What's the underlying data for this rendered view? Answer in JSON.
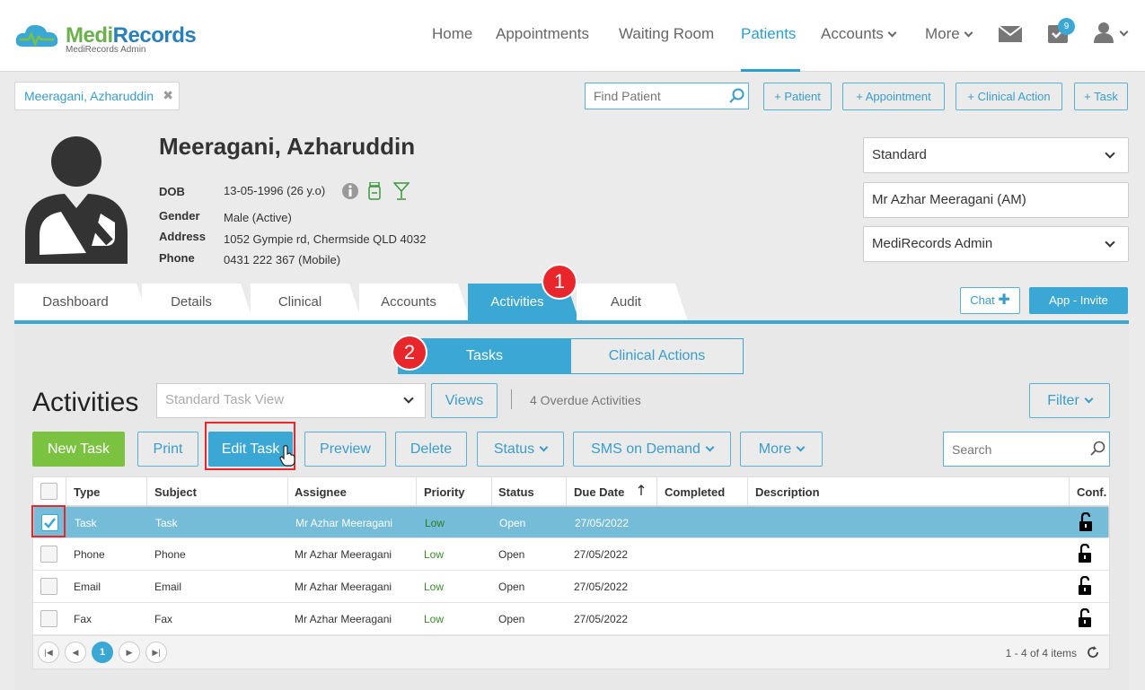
{
  "app": {
    "logo_title_a": "Medi",
    "logo_title_b": "Records",
    "logo_subtitle": "MediRecords Admin",
    "accent": "#3ba7d4",
    "brand_green": "#7cc241"
  },
  "nav": {
    "home": "Home",
    "appointments": "Appointments",
    "waiting_room": "Waiting Room",
    "patients": "Patients",
    "accounts": "Accounts",
    "more": "More",
    "task_badge": "9"
  },
  "toolbar": {
    "patient_chip": "Meeragani, Azharuddin",
    "find_placeholder": "Find Patient",
    "add_patient": "+ Patient",
    "add_appointment": "+ Appointment",
    "add_clinical_action": "+ Clinical Action",
    "add_task": "+ Task"
  },
  "patient": {
    "name": "Meeragani, Azharuddin",
    "dob_label": "DOB",
    "dob": "13-05-1996 (26 y.o)",
    "gender_label": "Gender",
    "gender": "Male (Active)",
    "address_label": "Address",
    "address": "1052 Gympie rd, Chermside QLD 4032",
    "phone_label": "Phone",
    "phone": "0431 222 367 (Mobile)"
  },
  "right_selects": {
    "type": "Standard",
    "practitioner": "Mr Azhar Meeragani (AM)",
    "practice": "MediRecords Admin"
  },
  "tabs": {
    "dashboard": "Dashboard",
    "details": "Details",
    "clinical": "Clinical",
    "accounts": "Accounts",
    "activities": "Activities",
    "audit": "Audit"
  },
  "chat_label": "Chat",
  "invite_label": "App - Invite",
  "segments": {
    "tasks": "Tasks",
    "clinical_actions": "Clinical Actions"
  },
  "steps": {
    "one": "1",
    "two": "2"
  },
  "activities": {
    "title": "Activities",
    "view_select": "Standard Task View",
    "views": "Views",
    "overdue": "4 Overdue Activities",
    "filter": "Filter",
    "new_task": "New Task",
    "print": "Print",
    "edit_task": "Edit Task",
    "preview": "Preview",
    "delete": "Delete",
    "status": "Status",
    "sms": "SMS on Demand",
    "more": "More",
    "search_placeholder": "Search"
  },
  "grid": {
    "headers": {
      "type": "Type",
      "subject": "Subject",
      "assignee": "Assignee",
      "priority": "Priority",
      "status": "Status",
      "due_date": "Due Date",
      "completed": "Completed",
      "description": "Description",
      "conf": "Conf."
    },
    "rows": [
      {
        "type": "Task",
        "subject": "Task",
        "assignee": "Mr Azhar Meeragani",
        "priority": "Low",
        "status": "Open",
        "due": "27/05/2022"
      },
      {
        "type": "Phone",
        "subject": "Phone",
        "assignee": "Mr Azhar Meeragani",
        "priority": "Low",
        "status": "Open",
        "due": "27/05/2022"
      },
      {
        "type": "Email",
        "subject": "Email",
        "assignee": "Mr Azhar Meeragani",
        "priority": "Low",
        "status": "Open",
        "due": "27/05/2022"
      },
      {
        "type": "Fax",
        "subject": "Fax",
        "assignee": "Mr Azhar Meeragani",
        "priority": "Low",
        "status": "Open",
        "due": "27/05/2022"
      }
    ],
    "page": "1",
    "items_text": "1 - 4 of 4 items"
  }
}
